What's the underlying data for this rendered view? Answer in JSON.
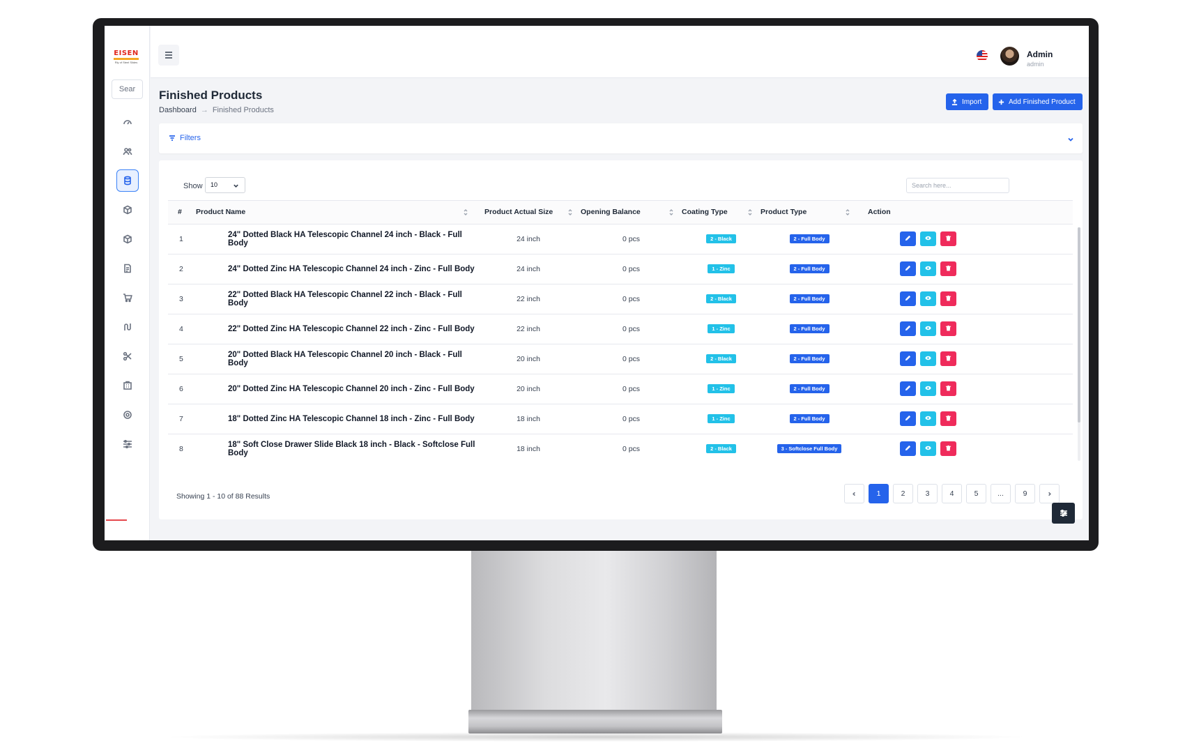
{
  "brand": {
    "logo_text": "EISEN",
    "logo_sub": "Rly of Steel Slides"
  },
  "sidebar": {
    "search_text": "Sear",
    "items": [
      {
        "icon": "dashboard-icon",
        "active": false
      },
      {
        "icon": "users-icon",
        "active": false
      },
      {
        "icon": "database-icon",
        "active": true
      },
      {
        "icon": "box-icon",
        "active": false
      },
      {
        "icon": "package-icon",
        "active": false
      },
      {
        "icon": "report-icon",
        "active": false
      },
      {
        "icon": "cart-icon",
        "active": false
      },
      {
        "icon": "route-icon",
        "active": false
      },
      {
        "icon": "scissors-icon",
        "active": false
      },
      {
        "icon": "building-icon",
        "active": false
      },
      {
        "icon": "settings-icon",
        "active": false
      },
      {
        "icon": "sliders-icon",
        "active": false
      }
    ]
  },
  "topbar": {
    "user_name": "Admin",
    "user_role": "admin"
  },
  "page": {
    "title": "Finished Products",
    "breadcrumb": [
      "Dashboard",
      "Finished Products"
    ],
    "import_label": "Import",
    "add_label": "Add Finished Product",
    "filters_label": "Filters"
  },
  "table": {
    "show_label": "Show",
    "page_size": "10",
    "search_placeholder": "Search here...",
    "columns": [
      "#",
      "Product Name",
      "Product Actual Size",
      "Opening Balance",
      "Coating Type",
      "Product Type",
      "Action"
    ],
    "rows": [
      {
        "n": "1",
        "name": "24\" Dotted Black HA Telescopic Channel 24 inch - Black - Full Body",
        "size": "24 inch",
        "balance": "0 pcs",
        "coating": "2 - Black",
        "type": "2 - Full Body"
      },
      {
        "n": "2",
        "name": "24\" Dotted Zinc HA Telescopic Channel 24 inch - Zinc - Full Body",
        "size": "24 inch",
        "balance": "0 pcs",
        "coating": "1 - Zinc",
        "type": "2 - Full Body"
      },
      {
        "n": "3",
        "name": "22\" Dotted Black HA Telescopic Channel 22 inch - Black - Full Body",
        "size": "22 inch",
        "balance": "0 pcs",
        "coating": "2 - Black",
        "type": "2 - Full Body"
      },
      {
        "n": "4",
        "name": "22\" Dotted Zinc HA Telescopic Channel 22 inch - Zinc - Full Body",
        "size": "22 inch",
        "balance": "0 pcs",
        "coating": "1 - Zinc",
        "type": "2 - Full Body"
      },
      {
        "n": "5",
        "name": "20\" Dotted Black HA Telescopic Channel 20 inch - Black - Full Body",
        "size": "20 inch",
        "balance": "0 pcs",
        "coating": "2 - Black",
        "type": "2 - Full Body"
      },
      {
        "n": "6",
        "name": "20\" Dotted Zinc HA Telescopic Channel 20 inch - Zinc - Full Body",
        "size": "20 inch",
        "balance": "0 pcs",
        "coating": "1 - Zinc",
        "type": "2 - Full Body"
      },
      {
        "n": "7",
        "name": "18\" Dotted Zinc HA Telescopic Channel 18 inch - Zinc - Full Body",
        "size": "18 inch",
        "balance": "0 pcs",
        "coating": "1 - Zinc",
        "type": "2 - Full Body"
      },
      {
        "n": "8",
        "name": "18\" Soft Close Drawer Slide Black 18 inch - Black - Softclose Full Body",
        "size": "18 inch",
        "balance": "0 pcs",
        "coating": "2 - Black",
        "type": "3 - Softclose Full Body"
      }
    ]
  },
  "pagination": {
    "results_text": "Showing 1 - 10 of 88 Results",
    "pages": [
      "1",
      "2",
      "3",
      "4",
      "5",
      "...",
      "9"
    ],
    "current": "1"
  },
  "colors": {
    "primary": "#2563eb",
    "cyan": "#22c1e8",
    "danger": "#ef2b5b",
    "dark": "#1f2937"
  }
}
